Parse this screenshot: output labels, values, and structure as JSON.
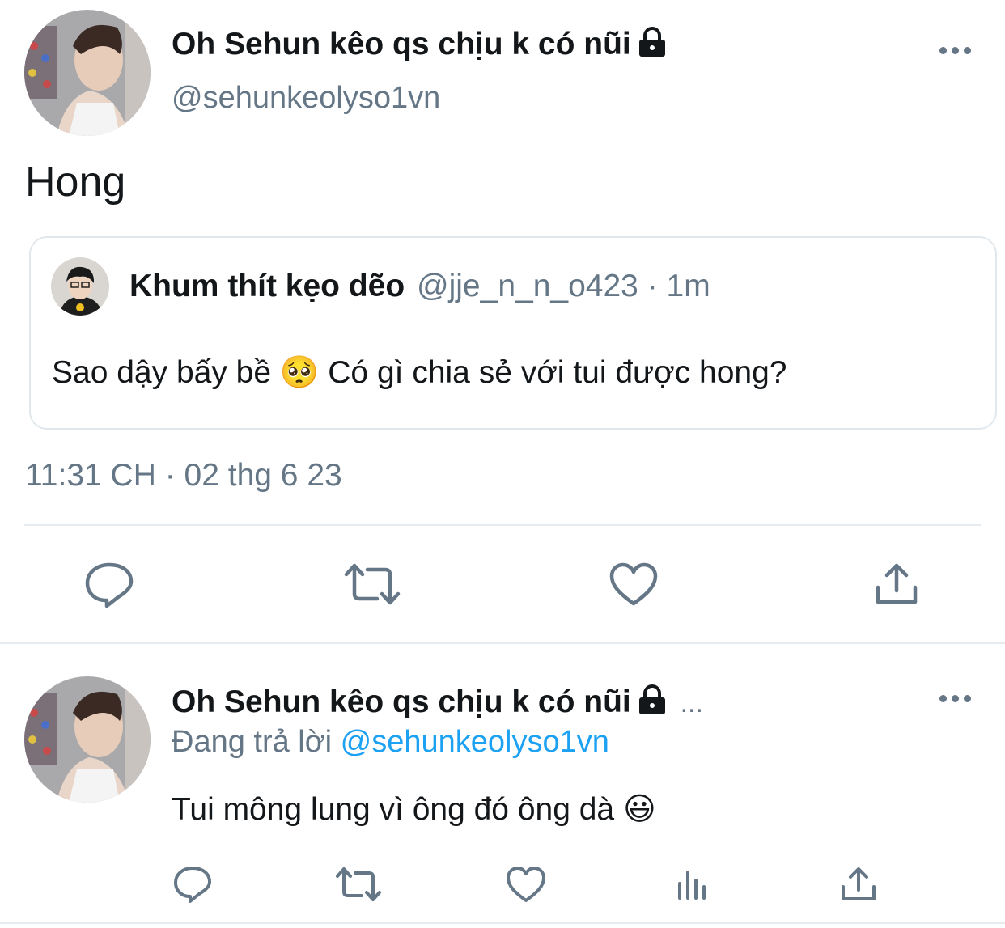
{
  "main_tweet": {
    "display_name": "Oh Sehun kêo qs chịu k có nũi",
    "handle": "@sehunkeolyso1vn",
    "text": "Hong",
    "timestamp": "11:31 CH · 02 thg 6 23",
    "quoted": {
      "display_name": "Khum thít kẹo dẽo",
      "handle": "@jje_n_n_o423",
      "separator": "·",
      "time": "1m",
      "text": "Sao dậy bấy bề 🥺 Có gì chia sẻ với tui được hong?"
    }
  },
  "reply": {
    "display_name": "Oh Sehun kêo qs chịu k có nũi",
    "ellipsis": "...",
    "replying_prefix": "Đang trả lời",
    "replying_to": "@sehunkeolyso1vn",
    "text": "Tui mông lung vì ông đó ông dà 😃"
  },
  "colors": {
    "link": "#1da1f2",
    "icon": "#657786",
    "divider": "#e6ecf0"
  },
  "icons": [
    "more-icon",
    "lock-icon",
    "reply-icon",
    "retweet-icon",
    "like-icon",
    "share-icon",
    "analytics-icon"
  ]
}
